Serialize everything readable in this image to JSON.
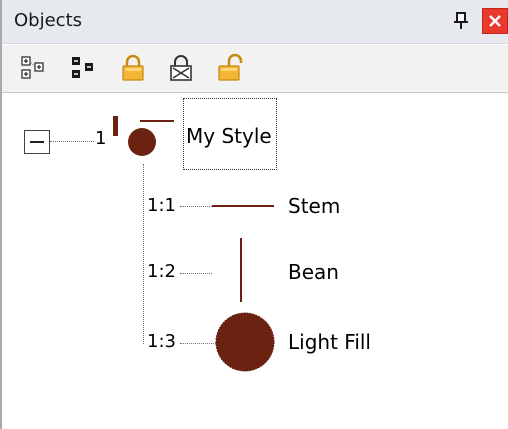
{
  "window": {
    "title": "Objects",
    "close_label": "x"
  },
  "toolbar": {
    "tools": [
      {
        "icon": "expand-all-icon"
      },
      {
        "icon": "collapse-all-icon"
      },
      {
        "icon": "lock-icon"
      },
      {
        "icon": "lock-toggle-icon"
      },
      {
        "icon": "unlock-icon"
      }
    ]
  },
  "tree": {
    "root": {
      "index": "1",
      "label": "My Style"
    },
    "children": [
      {
        "index": "1:1",
        "label": "Stem"
      },
      {
        "index": "1:2",
        "label": "Bean"
      },
      {
        "index": "1:3",
        "label": "Light Fill"
      }
    ]
  },
  "colors": {
    "swatch": "#6b2210",
    "titlebar": "#e6e9ee",
    "close": "#e8392c",
    "lock_gold": "#f2b632"
  }
}
